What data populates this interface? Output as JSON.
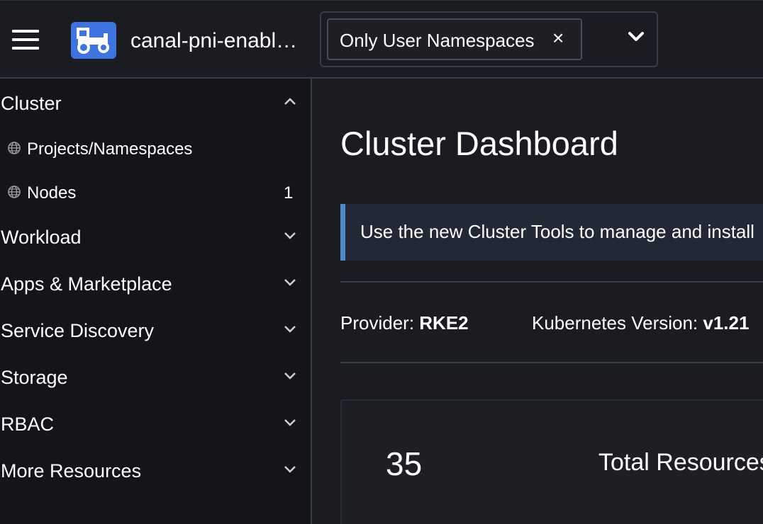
{
  "header": {
    "menu_icon": "hamburger-icon",
    "logo_icon": "tractor-icon",
    "cluster_name": "canal-pni-enabl…",
    "namespace_filter": {
      "selected": "Only User Namespaces",
      "remove_glyph": "×",
      "dropdown_icon": "chevron-down-icon"
    }
  },
  "sidebar": {
    "groups": [
      {
        "label": "Cluster",
        "expanded": true,
        "items": [
          {
            "label": "Projects/Namespaces",
            "icon": "globe-icon",
            "count": ""
          },
          {
            "label": "Nodes",
            "icon": "globe-icon",
            "count": "1"
          }
        ]
      },
      {
        "label": "Workload",
        "expanded": false
      },
      {
        "label": "Apps & Marketplace",
        "expanded": false
      },
      {
        "label": "Service Discovery",
        "expanded": false
      },
      {
        "label": "Storage",
        "expanded": false
      },
      {
        "label": "RBAC",
        "expanded": false
      },
      {
        "label": "More Resources",
        "expanded": false
      }
    ]
  },
  "main": {
    "title": "Cluster Dashboard",
    "banner": "Use the new Cluster Tools to manage and install",
    "provider_label": "Provider:",
    "provider_value": "RKE2",
    "k8s_label": "Kubernetes Version:",
    "k8s_value": "v1.21",
    "card": {
      "count": "35",
      "label": "Total Resources"
    }
  },
  "colors": {
    "background": "#1b1c21",
    "sidebar": "#141519",
    "accent": "#3d74e0",
    "banner_border": "#4f88c6"
  }
}
